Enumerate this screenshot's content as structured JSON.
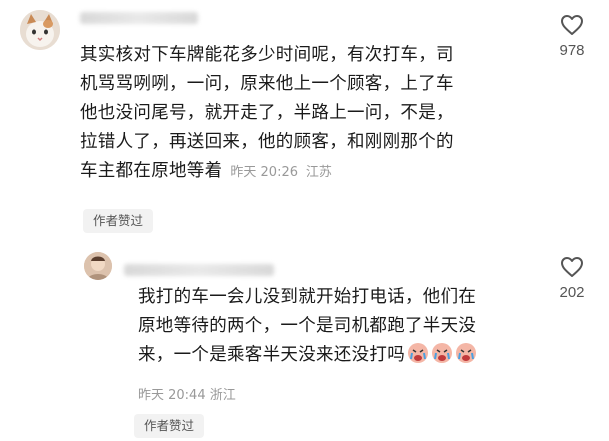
{
  "comments": [
    {
      "text": "其实核对下车牌能花多少时间呢，有次打车，司机骂骂咧咧，一问，原来他上一个顾客，上了车他也没问尾号，就开走了，半路上一问，不是，拉错人了，再送回来，他的顾客，和刚刚那个的车主都在原地等着",
      "lines": [
        "其实核对下车牌能花多少时间呢，有次打车，司",
        "机骂骂咧咧，一问，原来他上一个顾客，上了车",
        "他也没问尾号，就开走了，半路上一问，不是，",
        "拉错人了，再送回来，他的顾客，和刚刚那个的",
        "车主都在原地等着"
      ],
      "time": "昨天 20:26",
      "location": "江苏",
      "badge": "作者赞过",
      "likes": "978"
    },
    {
      "lines": [
        "我打的车一会儿没到就开始打电话，他们在",
        "原地等待的两个，一个是司机都跑了半天没",
        "来，一个是乘客半天没来还没打吗"
      ],
      "emoji_count": 3,
      "time": "昨天 20:44",
      "location": "浙江",
      "badge": "作者赞过",
      "likes": "202"
    }
  ],
  "icons": {
    "like": "heart-outline-icon",
    "emoji": "crying-face-emoji-icon"
  }
}
